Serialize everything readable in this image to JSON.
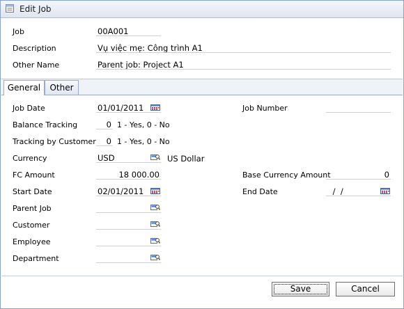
{
  "window": {
    "title": "Edit Job"
  },
  "header": {
    "job": {
      "label": "Job",
      "value": "00A001"
    },
    "description": {
      "label": "Description",
      "value": "Vụ việc mẹ: Công trình A1"
    },
    "other_name": {
      "label": "Other Name",
      "value": "Parent job: Project A1"
    }
  },
  "tabs": [
    {
      "label": "General",
      "active": true
    },
    {
      "label": "Other",
      "active": false
    }
  ],
  "general": {
    "job_date": {
      "label": "Job Date",
      "value": "01/01/2011"
    },
    "job_number": {
      "label": "Job Number",
      "value": ""
    },
    "balance_tracking": {
      "label": "Balance Tracking",
      "value": "0",
      "hint": "1 - Yes, 0 - No"
    },
    "tracking_by_customer": {
      "label": "Tracking by Customer",
      "value": "0",
      "hint": "1 - Yes, 0 - No"
    },
    "currency": {
      "label": "Currency",
      "value": "USD",
      "name": "US Dollar"
    },
    "fc_amount": {
      "label": "FC Amount",
      "value": "18 000.00"
    },
    "base_currency_amount": {
      "label": "Base Currency Amount",
      "value": "0"
    },
    "start_date": {
      "label": "Start Date",
      "value": "02/01/2011"
    },
    "end_date": {
      "label": "End Date",
      "value": " /  /"
    },
    "parent_job": {
      "label": "Parent Job",
      "value": ""
    },
    "customer": {
      "label": "Customer",
      "value": ""
    },
    "employee": {
      "label": "Employee",
      "value": ""
    },
    "department": {
      "label": "Department",
      "value": ""
    }
  },
  "buttons": {
    "save": "Save",
    "cancel": "Cancel"
  },
  "colors": {
    "border": "#8aa2c8",
    "titlebar": "#dfe6f1",
    "field_underline": "#c8d0dc"
  }
}
